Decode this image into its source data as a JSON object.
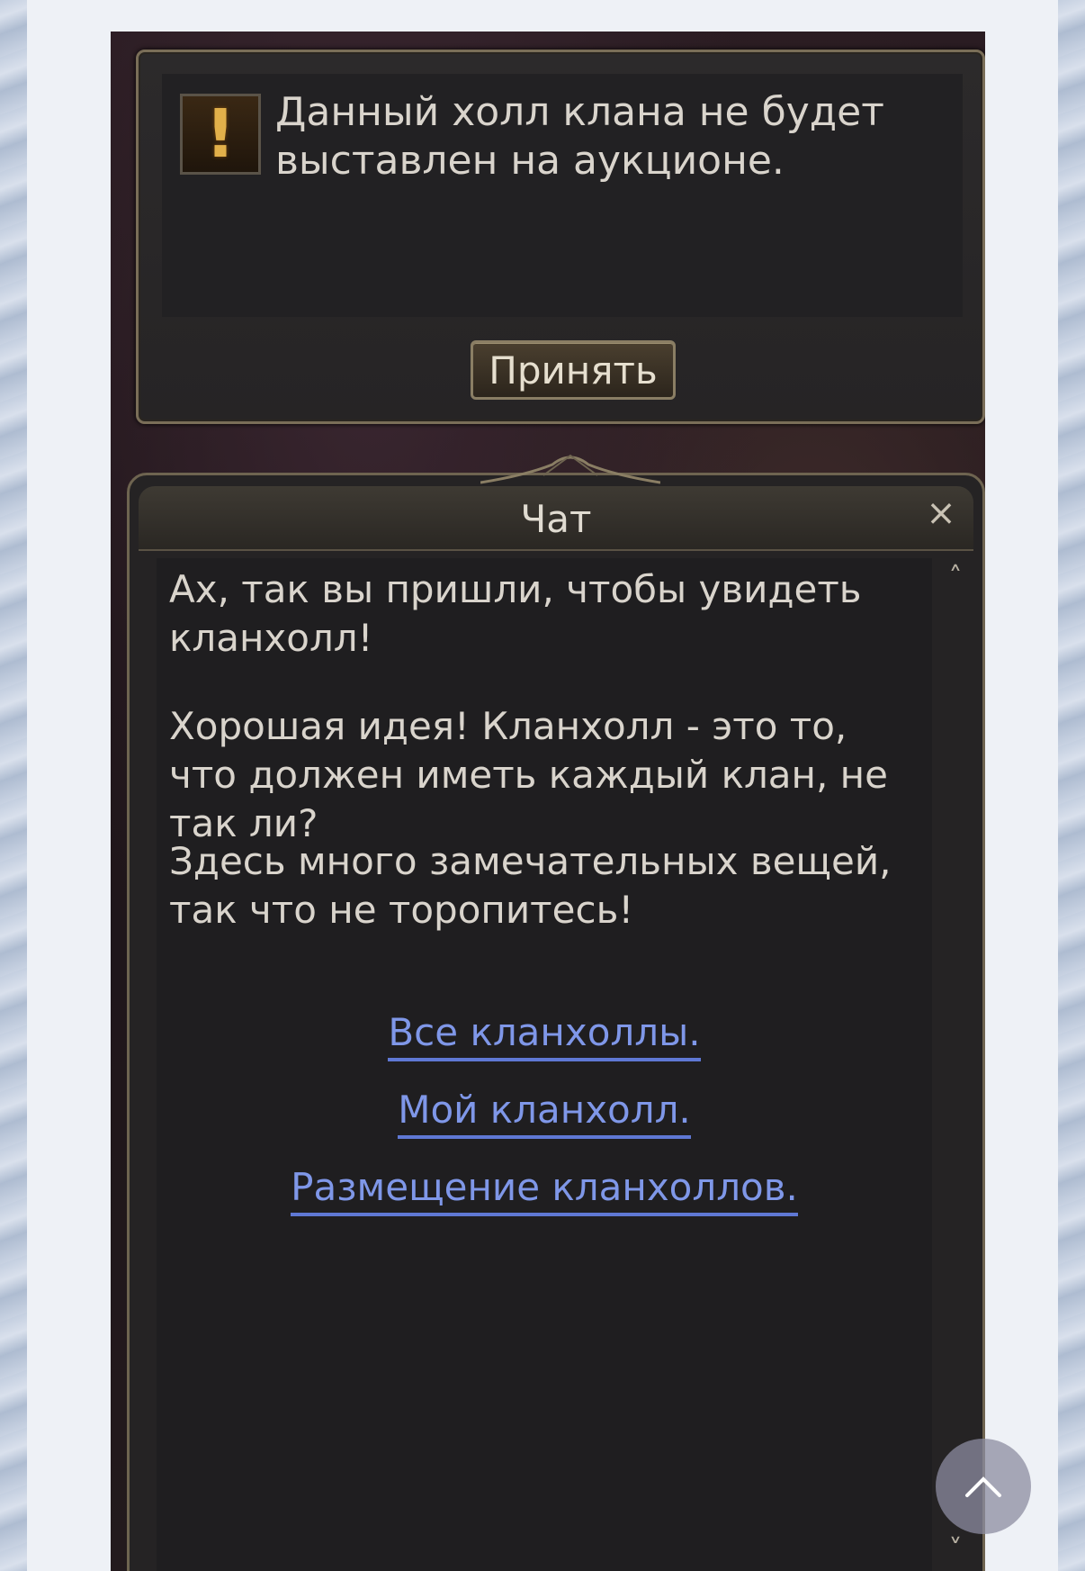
{
  "notice": {
    "icon": "warning-icon",
    "message": "Данный холл клана не будет выставлен на аукционе.",
    "accept_label": "Принять"
  },
  "chat": {
    "title": "Чат",
    "close_icon": "close-icon",
    "paragraphs": [
      "Ах, так вы пришли, чтобы увидеть кланхолл!",
      "Хорошая идея! Кланхолл - это то, что должен иметь каждый клан, не так ли?",
      "Здесь много замечательных вещей, так что не торопитесь!"
    ],
    "links": [
      "Все кланхоллы.",
      "Мой кланхолл.",
      "Размещение кланхоллов."
    ],
    "link_color": "#7f97e8",
    "scroll_up_icon": "chevron-up-icon",
    "scroll_down_icon": "chevron-down-icon"
  },
  "page": {
    "back_to_top_icon": "arrow-up-icon"
  }
}
